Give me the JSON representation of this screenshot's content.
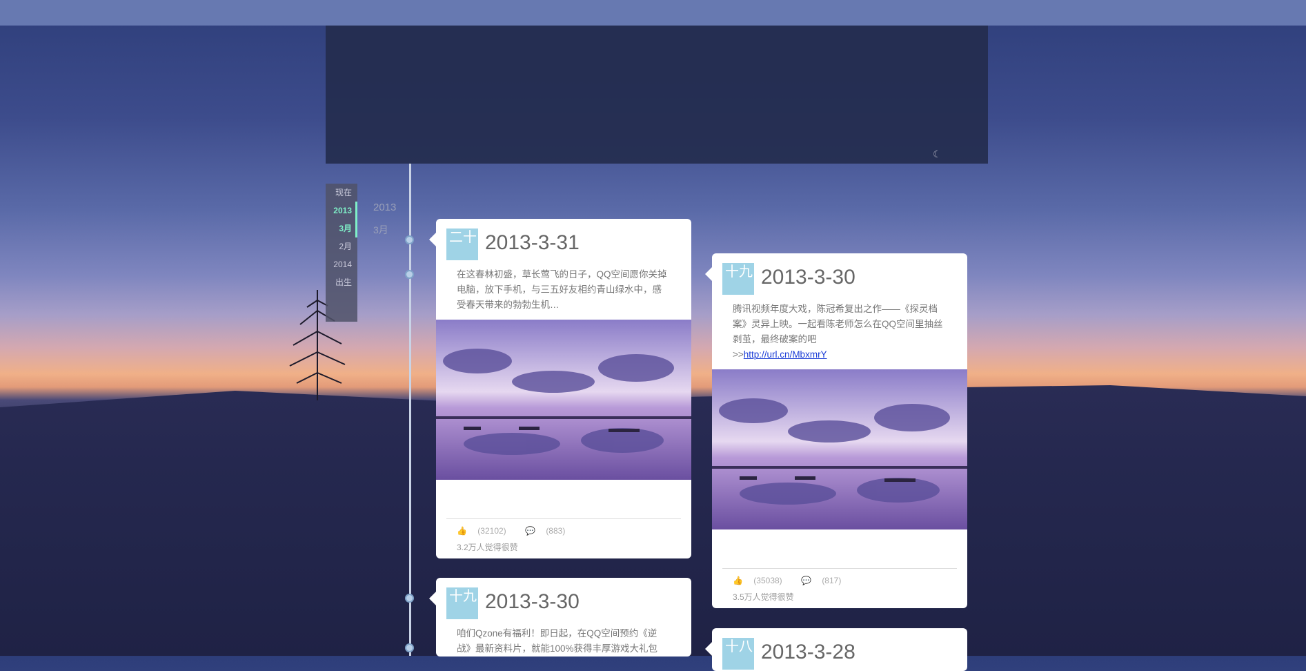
{
  "nav": {
    "items": [
      {
        "label": "现在",
        "active": false
      },
      {
        "label": "2013",
        "active": true
      },
      {
        "label": "3月",
        "active": true
      },
      {
        "label": "2月",
        "active": false
      },
      {
        "label": "2014",
        "active": false
      },
      {
        "label": "出生",
        "active": false
      }
    ]
  },
  "timeline": {
    "year": "2013",
    "month": "3月"
  },
  "cards": [
    {
      "badge": "二十",
      "date": "2013-3-31",
      "text": "在这春林初盛，草长莺飞的日子，QQ空间愿你关掉电脑，放下手机，与三五好友相约青山绿水中，感受春天带来的勃勃生机…",
      "like_count": "(32102)",
      "comment_count": "(883)",
      "likes_text": "3.2万人觉得很赞"
    },
    {
      "badge": "十九",
      "date": "2013-3-30",
      "text": "腾讯视频年度大戏，陈冠希复出之作——《探灵档案》灵异上映。一起看陈老师怎么在QQ空间里抽丝剥茧，最终破案的吧",
      "link_prefix": ">>",
      "link": "http://url.cn/MbxmrY",
      "like_count": "(35038)",
      "comment_count": "(817)",
      "likes_text": "3.5万人觉得很赞"
    },
    {
      "badge": "十九",
      "date": "2013-3-30",
      "text": "咱们Qzone有福利！即日起，在QQ空间预约《逆战》最新资料片，就能100%获得丰厚游戏大礼包"
    },
    {
      "badge": "十八",
      "date": "2013-3-28"
    }
  ]
}
